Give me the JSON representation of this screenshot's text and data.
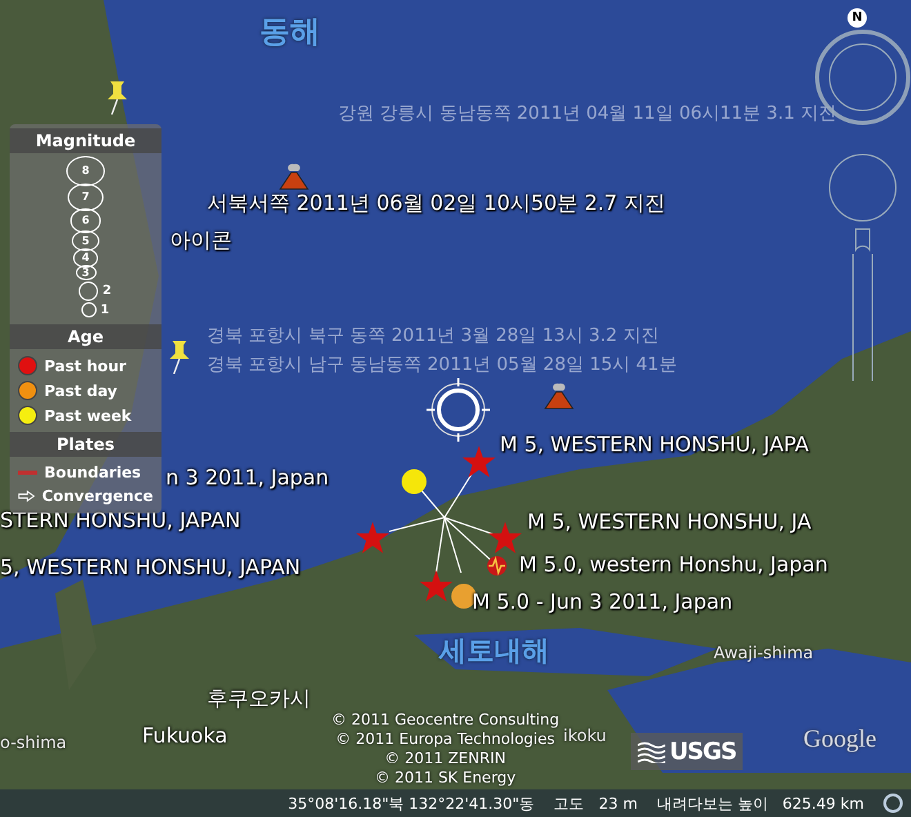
{
  "sea_labels": [
    "동해",
    "세토내해"
  ],
  "placemark_labels": [
    {
      "text": "강원 강릉시 동남동쪽 2011년 04월 11일 06시11분 3.1 지진",
      "kind": "faint"
    },
    {
      "text": "서북서쪽 2011년 06월 02일 10시50분 2.7 지진",
      "kind": "bold"
    },
    {
      "text": "아이콘",
      "kind": "bold"
    },
    {
      "text": "경북 포항시 북구 동쪽 2011년 3월 28일 13시 3.2 지진",
      "kind": "faint"
    },
    {
      "text": "경북 포항시 남구 동남동쪽 2011년 05월 28일 15시 41분",
      "kind": "faint"
    },
    {
      "text": "M 5, WESTERN HONSHU, JAPA",
      "kind": "bold"
    },
    {
      "text": "n  3 2011, Japan",
      "kind": "bold"
    },
    {
      "text": "STERN HONSHU, JAPAN",
      "kind": "bold"
    },
    {
      "text": "M 5, WESTERN HONSHU, JA",
      "kind": "bold"
    },
    {
      "text": "5, WESTERN HONSHU, JAPAN",
      "kind": "bold"
    },
    {
      "text": "M 5.0, western Honshu, Japan",
      "kind": "bold"
    },
    {
      "text": "M 5.0 - Jun  3 2011, Japan",
      "kind": "bold"
    },
    {
      "text": "Awaji-shima",
      "kind": "place"
    },
    {
      "text": "후쿠오카시",
      "kind": "city"
    },
    {
      "text": "o-shima",
      "kind": "place"
    },
    {
      "text": "Fukuoka",
      "kind": "city"
    },
    {
      "text": "ikoku",
      "kind": "place"
    }
  ],
  "markers": [
    {
      "kind": "star",
      "color": "#d41010"
    },
    {
      "kind": "star",
      "color": "#d41010"
    },
    {
      "kind": "star",
      "color": "#d41010"
    },
    {
      "kind": "star",
      "color": "#d41010"
    },
    {
      "kind": "dot",
      "color": "#f5e60a"
    },
    {
      "kind": "dot",
      "color": "#e8a030"
    },
    {
      "kind": "quake",
      "color": "#c81818"
    },
    {
      "kind": "pin",
      "color": "#f0e040"
    },
    {
      "kind": "pin",
      "color": "#f0e040"
    },
    {
      "kind": "volcano",
      "color": "#c84010"
    },
    {
      "kind": "volcano",
      "color": "#c84010"
    }
  ],
  "legend": {
    "magnitude": {
      "title": "Magnitude",
      "sizes": [
        "8",
        "7",
        "6",
        "5",
        "4",
        "3",
        "2",
        "1"
      ]
    },
    "age": {
      "title": "Age",
      "items": [
        {
          "label": "Past hour",
          "color": "#e01010"
        },
        {
          "label": "Past day",
          "color": "#f09010"
        },
        {
          "label": "Past week",
          "color": "#f5ee10"
        }
      ]
    },
    "plates": {
      "title": "Plates",
      "items": [
        {
          "label": "Boundaries",
          "kind": "line"
        },
        {
          "label": "Convergence",
          "kind": "arrow"
        }
      ]
    }
  },
  "copyright": [
    "© 2011 Geocentre Consulting",
    "© 2011 Europa Technologies",
    "© 2011 ZENRIN",
    "© 2011 SK Energy"
  ],
  "logos": {
    "usgs": "USGS",
    "google": "Google"
  },
  "compass": {
    "north": "N"
  },
  "status_bar": {
    "coordinates": "35°08'16.18\"북 132°22'41.30\"동",
    "elevation": "고도   23 m",
    "eye_altitude": "내려다보는 높이   625.49 km"
  }
}
